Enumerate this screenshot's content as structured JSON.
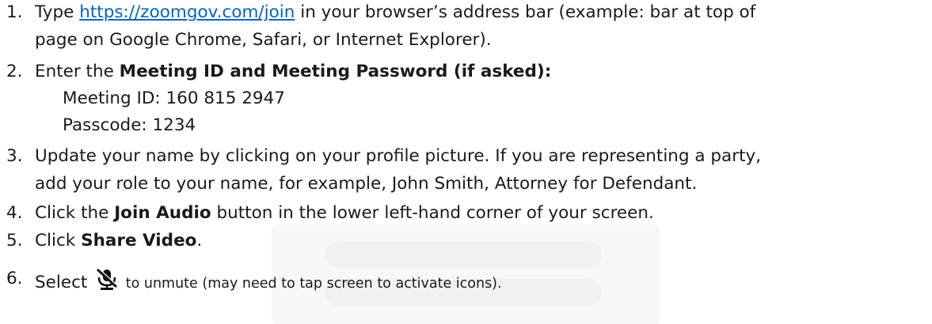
{
  "steps": [
    {
      "number": "1.",
      "line1_before": "Type ",
      "link": "https://zoomgov.com/join",
      "line1_after": " in your browser’s address bar (example: bar at top of",
      "line2": "page on Google Chrome, Safari, or Internet Explorer)."
    },
    {
      "number": "2.",
      "before": "Enter the ",
      "bold": "Meeting ID and Meeting Password (if asked):",
      "meeting_id": "Meeting ID: 160 815 2947",
      "passcode": "Passcode: 1234"
    },
    {
      "number": "3.",
      "line1": "Update your name by clicking on your profile picture. If you are representing a party,",
      "line2": "add your role to your name, for example, John Smith, Attorney for Defendant."
    },
    {
      "number": "4.",
      "before": "Click the ",
      "bold": "Join Audio",
      "after": " button in the lower left-hand corner of your screen."
    },
    {
      "number": "5.",
      "before": "Click ",
      "bold": "Share Video",
      "after": "."
    },
    {
      "number": "6.",
      "before": "Select ",
      "icon": "muted-microphone-icon",
      "after": " to unmute (may need to tap screen to activate icons)."
    }
  ]
}
